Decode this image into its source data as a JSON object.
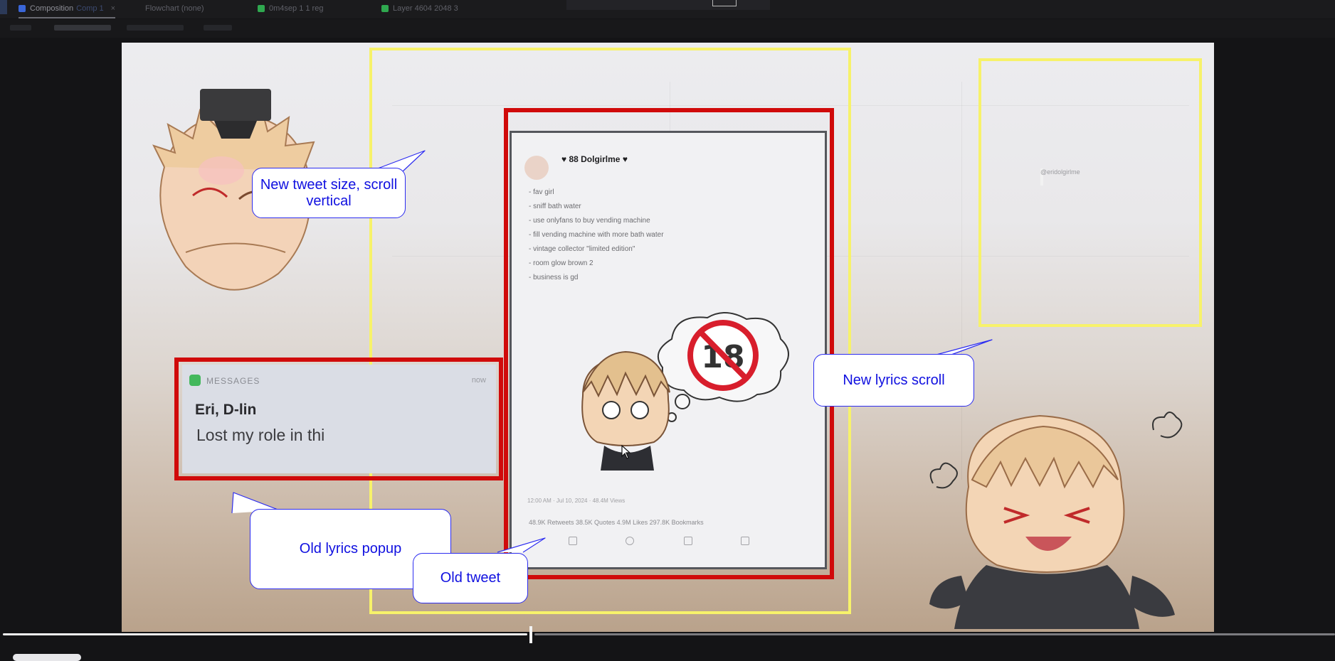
{
  "tabs": [
    {
      "label": "Composition",
      "sub": "Comp 1",
      "close": "×",
      "icon_color": "#3a66d8",
      "active": true
    },
    {
      "label": "Flowchart (none)",
      "icon_color": "#1b1b1d",
      "active": false
    },
    {
      "label": "0m4sep 1 1 reg",
      "icon_color": "#2fa84f",
      "active": false
    },
    {
      "label": "Layer 4604 2048 3",
      "icon_color": "#2fa84f",
      "active": false
    }
  ],
  "annotations": {
    "new_tweet": "New tweet size, scroll vertical",
    "new_lyrics": "New lyrics scroll",
    "old_lyrics": "Old lyrics popup",
    "old_tweet": "Old tweet"
  },
  "message_popup": {
    "app": "MESSAGES",
    "time": "now",
    "sender": "Eri, D-lin",
    "body": "Lost my role in thi"
  },
  "tweet": {
    "display_name": "♥ 88 Dolgirlme ♥",
    "handle": "@eridolgirlme",
    "lines": [
      "- fav girl",
      "- sniff bath water",
      "- use onlyfans to buy vending machine",
      "- fill vending machine with more bath water",
      "- vintage collector \"limited edition\"",
      "- room glow brown 2",
      "- business is gd"
    ],
    "timestamp": "12:00 AM · Jul 10, 2024 · 48.4M Views",
    "stats": "48.9K Retweets   38.5K Quotes   4.9M Likes   297.8K Bookmarks",
    "sticker_text": "18"
  },
  "colors": {
    "highlight_yellow": "#f7f26a",
    "highlight_red": "#d00a0a",
    "annotation_text": "#1010e0",
    "annotation_border": "#2d2df0"
  },
  "playback": {
    "progress_fraction": 0.395
  }
}
